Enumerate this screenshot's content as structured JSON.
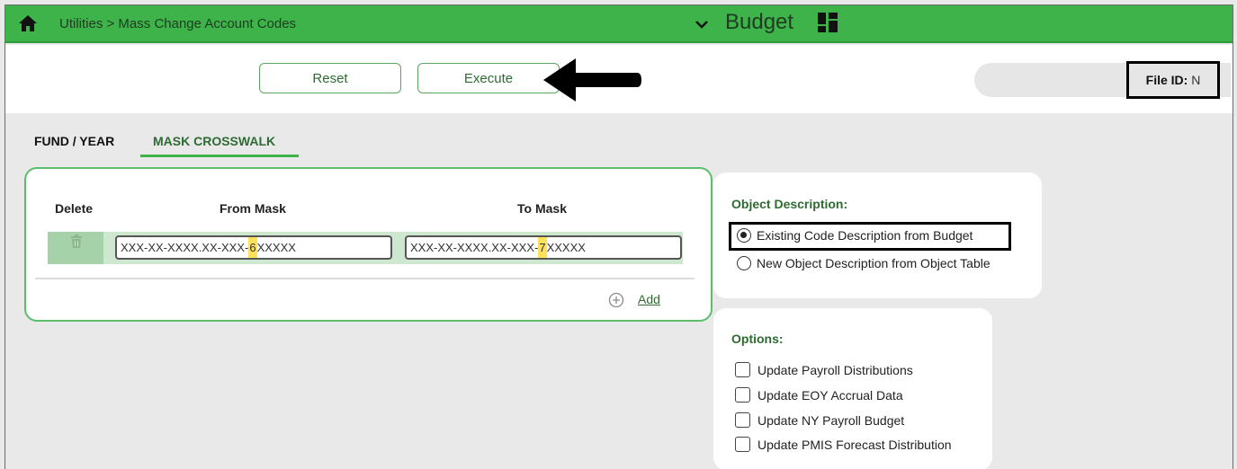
{
  "header": {
    "breadcrumb": "Utilities > Mass Change Account Codes",
    "module": "Budget",
    "icons": {
      "home": "home-icon",
      "dropdown": "chevron-down-icon",
      "app_menu": "grid-icon"
    },
    "bg_color": "#3db34a"
  },
  "toolbar": {
    "reset_label": "Reset",
    "execute_label": "Execute",
    "file_id_label": "File ID:",
    "file_id_value": "N"
  },
  "tabs": [
    {
      "label": "FUND / YEAR",
      "active": false
    },
    {
      "label": "MASK CROSSWALK",
      "active": true
    }
  ],
  "mask_table": {
    "columns": [
      "Delete",
      "From Mask",
      "To Mask"
    ],
    "rows": [
      {
        "from": {
          "prefix": "XXX-XX-XXXX.XX-XXX-",
          "highlight": "6",
          "suffix": "XXXXX"
        },
        "to": {
          "prefix": "XXX-XX-XXXX.XX-XXX-",
          "highlight": "7",
          "suffix": "XXXXX"
        }
      }
    ],
    "add_label": "Add"
  },
  "object_description": {
    "title": "Object Description:",
    "options": [
      {
        "label": "Existing Code Description from Budget",
        "checked": true
      },
      {
        "label": "New Object Description from Object Table",
        "checked": false
      }
    ]
  },
  "options": {
    "title": "Options:",
    "items": [
      {
        "label": "Update Payroll Distributions",
        "checked": false
      },
      {
        "label": "Update EOY Accrual Data",
        "checked": false
      },
      {
        "label": "Update NY Payroll Budget",
        "checked": false
      },
      {
        "label": "Update PMIS Forecast Distribution",
        "checked": false
      }
    ]
  },
  "colors": {
    "accent": "#3db34a",
    "highlight": "#ffe15a",
    "label_green": "#2e6b33"
  }
}
